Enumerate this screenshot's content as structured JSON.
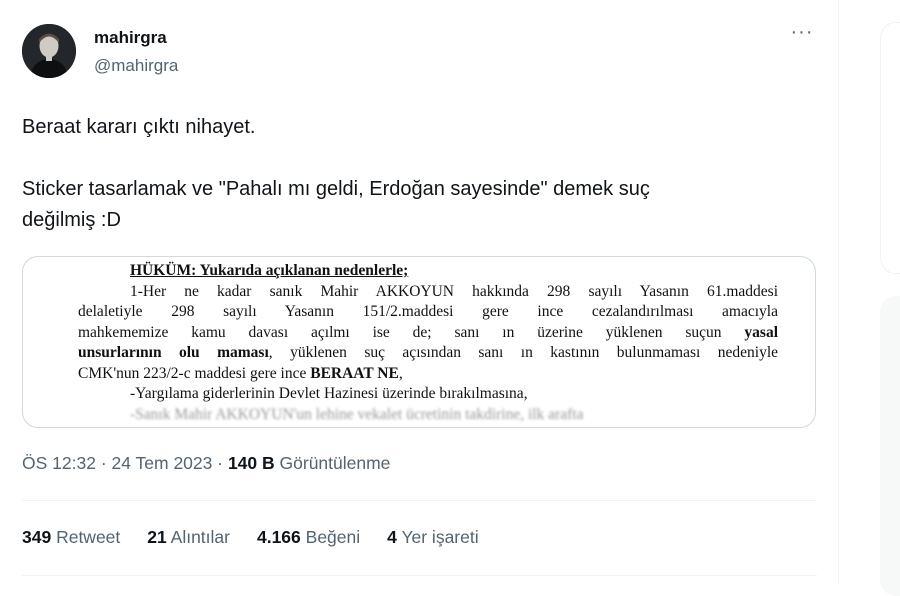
{
  "tweet": {
    "author": {
      "display_name": "mahirgra",
      "handle": "@mahirgra"
    },
    "more_icon": "more-horizontal-icon",
    "text": {
      "para1": "Beraat kararı çıktı nihayet.",
      "para2_line1": "Sticker tasarlamak ve \"Pahalı mı geldi, Erdoğan sayesinde\" demek suç",
      "para2_line2": "değilmiş :D"
    },
    "document": {
      "heading": "HÜKÜM: Yukarıda açıklanan nedenlerle;",
      "line1": "1-Her ne kadar sanık Mahir AKKOYUN hakkında 298 sayılı Yasanın 61.maddesi",
      "line2": "delaletiyle 298 sayılı Yasanın 151/2.maddesi gere ince cezalandırılması amacıyla",
      "line3": "mahkememize kamu davası açılmı ise de; sanı ın üzerine yüklenen suçun",
      "line3_bold": "yasal",
      "line4_bold": "unsurlarının olu maması",
      "line4_rest": ", yüklenen suç açısından sanı ın kastının bulunmaması nedeniyle",
      "line5": "CMK'nun 223/2-c maddesi gere ince",
      "line5_bold": "BERAAT NE",
      "line5_end": ",",
      "line6": "-Yargılama giderlerinin Devlet Hazinesi üzerinde bırakılmasına,",
      "line7_cut": "-Sanık Mahir AKKOYUN'un lehine vekalet ücretinin takdirine, ilk arafta"
    },
    "meta": {
      "time": "ÖS 12:32",
      "sep1": " · ",
      "date": "24 Tem 2023",
      "sep2": " · ",
      "views": "140 B",
      "views_label": " Görüntülenme"
    },
    "stats": {
      "retweets": "349",
      "retweets_label": "Retweet",
      "quotes": "21",
      "quotes_label": "Alıntılar",
      "likes": "4.166",
      "likes_label": "Beğeni",
      "bookmarks": "4",
      "bookmarks_label": "Yer işareti"
    }
  },
  "colors": {
    "text_primary": "#0f1419",
    "text_secondary": "#536471",
    "border": "#cfd9de",
    "divider": "#eff3f4"
  }
}
